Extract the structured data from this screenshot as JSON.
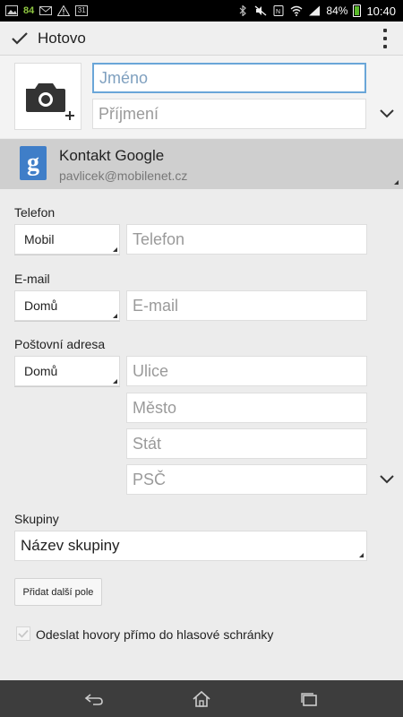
{
  "status_bar": {
    "notification_count": "84",
    "calendar_day": "31",
    "battery_percent": "84%",
    "time": "10:40"
  },
  "action_bar": {
    "done_label": "Hotovo"
  },
  "name_fields": {
    "first_name_placeholder": "Jméno",
    "last_name_placeholder": "Příjmení"
  },
  "account": {
    "title": "Kontakt Google",
    "email": "pavlicek@mobilenet.cz",
    "icon_letter": "g"
  },
  "phone": {
    "label": "Telefon",
    "type": "Mobil",
    "placeholder": "Telefon"
  },
  "email": {
    "label": "E-mail",
    "type": "Domů",
    "placeholder": "E-mail"
  },
  "address": {
    "label": "Poštovní adresa",
    "type": "Domů",
    "street_placeholder": "Ulice",
    "city_placeholder": "Město",
    "state_placeholder": "Stát",
    "zip_placeholder": "PSČ"
  },
  "groups": {
    "label": "Skupiny",
    "value": "Název skupiny"
  },
  "add_field_label": "Přidat další pole",
  "voicemail_checkbox": {
    "label": "Odeslat hovory přímo do hlasové schránky",
    "checked": true
  },
  "colors": {
    "focus_border": "#6aa6d8",
    "google_blue": "#3f7ec8",
    "navbar": "#3d3d3d"
  }
}
